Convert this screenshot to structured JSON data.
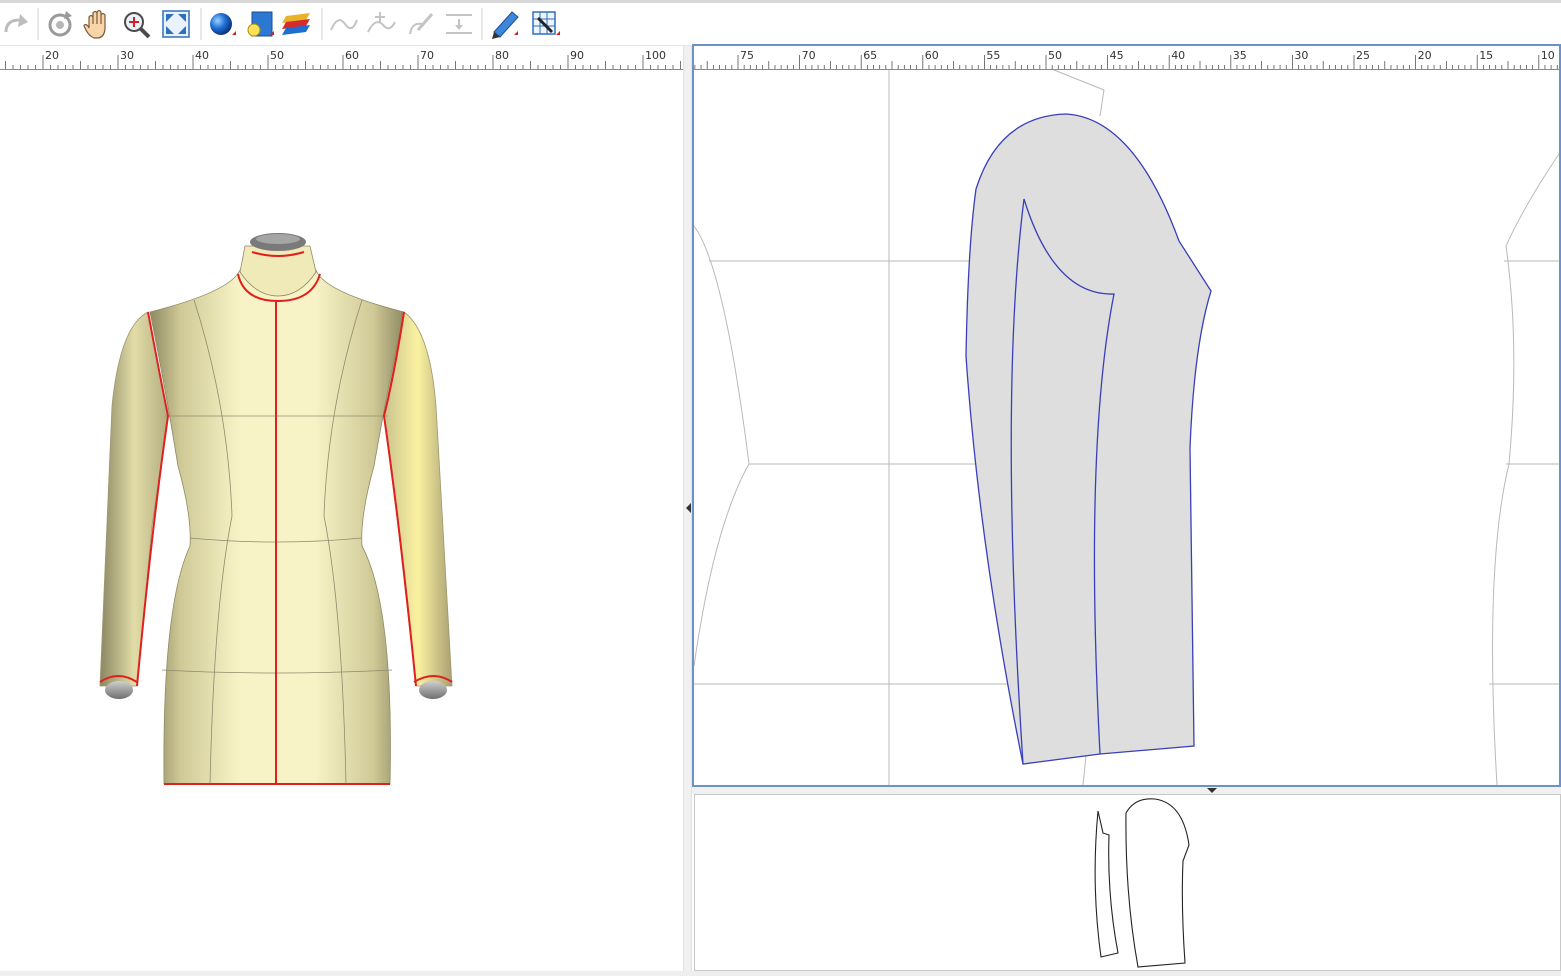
{
  "toolbar": {
    "buttons": [
      {
        "name": "redo-button",
        "icon": "redo-icon",
        "enabled": false
      },
      {
        "name": "rotate-view-button",
        "icon": "rotate-icon",
        "enabled": true
      },
      {
        "name": "pan-button",
        "icon": "hand-icon",
        "enabled": true
      },
      {
        "name": "zoom-button",
        "icon": "zoom-in-icon",
        "enabled": true
      },
      {
        "name": "fit-view-button",
        "icon": "fit-to-window-icon",
        "enabled": true
      },
      {
        "name": "shading-button",
        "icon": "sphere-icon",
        "enabled": true
      },
      {
        "name": "lighting-button",
        "icon": "light-panel-icon",
        "enabled": true
      },
      {
        "name": "layers-button",
        "icon": "layers-icon",
        "enabled": true
      },
      {
        "name": "curve-button",
        "icon": "curve-icon",
        "enabled": false
      },
      {
        "name": "add-point-button",
        "icon": "add-point-curve-icon",
        "enabled": false
      },
      {
        "name": "edit-curve-button",
        "icon": "edit-curve-icon",
        "enabled": false
      },
      {
        "name": "align-button",
        "icon": "align-icon",
        "enabled": false
      },
      {
        "name": "measure-button",
        "icon": "ruler-pencil-icon",
        "enabled": true
      },
      {
        "name": "settings-button",
        "icon": "grid-settings-icon",
        "enabled": true
      }
    ]
  },
  "left_ruler": {
    "labels": [
      "20",
      "30",
      "40",
      "50",
      "60",
      "70",
      "80",
      "90",
      "100"
    ]
  },
  "pattern_ruler": {
    "labels": [
      "75",
      "70",
      "65",
      "60",
      "55",
      "50",
      "45",
      "40",
      "35",
      "30",
      "25",
      "20",
      "15",
      "10"
    ]
  },
  "colors": {
    "accent_border": "#6f92c6",
    "seam_line": "#e0201e",
    "mannequin_body": "#f2eebc",
    "sleeve_fill": "#dedede",
    "pattern_outline": "#3a3fb8"
  }
}
